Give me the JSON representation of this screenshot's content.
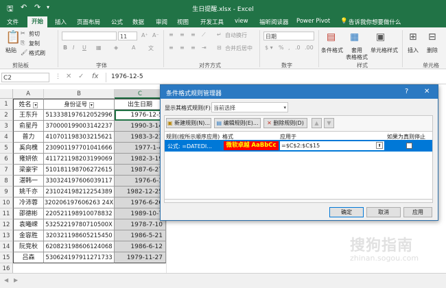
{
  "titlebar": {
    "title": "生日提醒.xlsx - Excel",
    "save_icon": "save-icon",
    "undo_icon": "undo-icon",
    "redo_icon": "redo-icon"
  },
  "ribbon_tabs": [
    "文件",
    "开始",
    "插入",
    "页面布局",
    "公式",
    "数据",
    "审阅",
    "视图",
    "开发工具",
    "view",
    "福昕阅读器",
    "Power Pivot"
  ],
  "tell_me": "告诉我你想要做什么",
  "ribbon": {
    "paste": "粘贴",
    "cut": "剪切",
    "copy": "复制",
    "format_painter": "格式刷",
    "clipboard": "剪贴板",
    "font_size": "11",
    "bold": "B",
    "italic": "I",
    "underline": "U",
    "font_group": "字体",
    "wrap_text": "自动换行",
    "merge_center": "合并后居中",
    "align_group": "对齐方式",
    "number_format": "日期",
    "number_group": "数字",
    "cond_format": "条件格式",
    "table_format_1": "套用",
    "table_format_2": "表格格式",
    "cell_styles": "单元格样式",
    "styles_group": "样式",
    "insert": "插入",
    "delete": "删除",
    "cells_group": "单元格"
  },
  "formula_bar": {
    "name_box": "C2",
    "value": "1976-12-5"
  },
  "columns": [
    "A",
    "B",
    "C"
  ],
  "headers": {
    "name": "姓名",
    "id": "身份证号",
    "birth": "出生日期"
  },
  "rows": [
    {
      "n": "王东升",
      "id": "513338197612052996",
      "d": "1976-12-5"
    },
    {
      "n": "俞星丹",
      "id": "370000199003142237",
      "d": "1990-3-14"
    },
    {
      "n": "普力",
      "id": "410701198303215621",
      "d": "1983-3-21"
    },
    {
      "n": "奚向槐",
      "id": "230901197701041666",
      "d": "1977-1-4"
    },
    {
      "n": "雍妍依",
      "id": "411721198203199069",
      "d": "1982-3-19"
    },
    {
      "n": "梁豪宇",
      "id": "510181198706272615",
      "d": "1987-6-27"
    },
    {
      "n": "湛韩一",
      "id": "330324197606039117",
      "d": "1976-6-3"
    },
    {
      "n": "姚千亦",
      "id": "231024198212254389",
      "d": "1982-12-25"
    },
    {
      "n": "冷沛蓉",
      "id": "320206197606263 24X",
      "d": "1976-6-26"
    },
    {
      "n": "邵德彬",
      "id": "220521198910078832",
      "d": "1989-10-7"
    },
    {
      "n": "袁曦嵘",
      "id": "53252219780710500X",
      "d": "1978-7-10"
    },
    {
      "n": "金容胜",
      "id": "320321198605215450",
      "d": "1986-5-21"
    },
    {
      "n": "阮竞秋",
      "id": "620823198606124068",
      "d": "1986-6-12"
    },
    {
      "n": "吕森",
      "id": "530624197911271733",
      "d": "1979-11-27"
    }
  ],
  "row_numbers": [
    "1",
    "2",
    "3",
    "4",
    "5",
    "6",
    "7",
    "8",
    "9",
    "10",
    "11",
    "12",
    "13",
    "14",
    "15",
    "16"
  ],
  "dialog": {
    "title": "条件格式规则管理器",
    "help": "?",
    "close": "✕",
    "show_label": "显示其格式规则(F):",
    "show_value": "当前选择",
    "new_rule": "新建规则(N)...",
    "edit_rule": "编辑规则(E)...",
    "delete_rule": "删除规则(D)",
    "col_rule": "规则(按所示顺序应用)",
    "col_format": "格式",
    "col_applies": "应用于",
    "col_stop": "如果为真则停止",
    "rule_text": "公式: =DATEDI...",
    "preview": "微软卓越  AaBbCc",
    "applies_value": "=$C$2:$C$15",
    "ok": "确定",
    "cancel": "取消",
    "apply": "应用"
  },
  "colors": {
    "excel_green": "#217346",
    "dialog_blue": "#2b79c2",
    "selection": "#0078d7",
    "preview_bg": "#ff0000",
    "preview_fg": "#ffff00"
  },
  "watermark": {
    "text": "搜狗指南",
    "url": "zhinan.sogou.com"
  }
}
